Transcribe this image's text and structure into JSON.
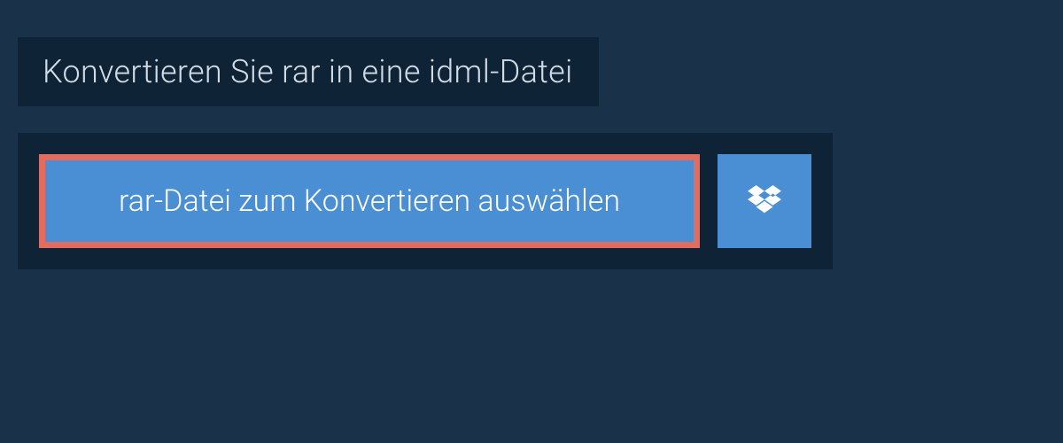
{
  "header": {
    "title": "Konvertieren Sie rar in eine idml-Datei"
  },
  "upload": {
    "select_button_label": "rar-Datei zum Konvertieren auswählen",
    "dropbox_icon": "dropbox-icon"
  },
  "colors": {
    "background": "#193249",
    "panel": "#0e2336",
    "button_primary": "#4a8fd3",
    "highlight_border": "#e26c5f",
    "text_light": "#d3dce5",
    "text_white": "#ffffff"
  }
}
